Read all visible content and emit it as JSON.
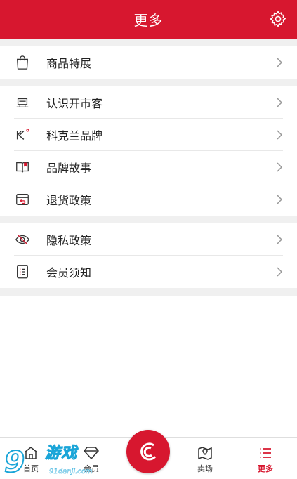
{
  "header": {
    "title": "更多"
  },
  "sections": [
    {
      "items": [
        {
          "label": "商品特展",
          "icon": "shopping-bag-icon"
        }
      ]
    },
    {
      "items": [
        {
          "label": "认识开市客",
          "icon": "store-icon"
        },
        {
          "label": "科克兰品牌",
          "icon": "kirkland-logo-icon"
        },
        {
          "label": "品牌故事",
          "icon": "book-icon"
        },
        {
          "label": "退货政策",
          "icon": "return-box-icon"
        }
      ]
    },
    {
      "items": [
        {
          "label": "隐私政策",
          "icon": "eye-off-icon"
        },
        {
          "label": "会员须知",
          "icon": "checklist-icon"
        }
      ]
    }
  ],
  "tabbar": {
    "tabs": [
      {
        "label": "首页",
        "icon": "home-icon"
      },
      {
        "label": "会员",
        "icon": "diamond-icon"
      },
      {
        "label": "卖场",
        "icon": "map-pin-icon"
      },
      {
        "label": "更多",
        "icon": "menu-list-icon",
        "active": true
      }
    ],
    "center_icon": "costco-logo-icon"
  },
  "watermark": {
    "text": "游戏",
    "url": "91danji.com",
    "logo": "9"
  },
  "colors": {
    "accent": "#d7172f",
    "background": "#f0f0f0"
  }
}
